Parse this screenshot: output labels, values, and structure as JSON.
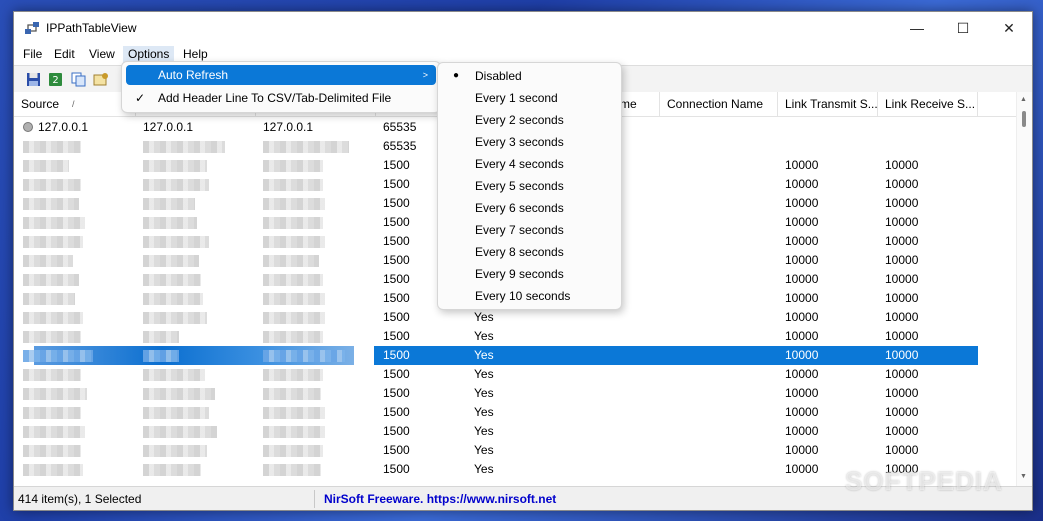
{
  "window": {
    "title": "IPPathTableView",
    "controls": {
      "minimize": "—",
      "maximize": "☐",
      "close": "✕"
    }
  },
  "menubar": {
    "items": [
      "File",
      "Edit",
      "View",
      "Options",
      "Help"
    ],
    "active": "Options"
  },
  "toolbar": {
    "icons": [
      "save-icon",
      "refresh-icon",
      "copy-icon",
      "properties-icon"
    ]
  },
  "table": {
    "columns": [
      "Source",
      "",
      "",
      "",
      "",
      "me",
      "Connection Name",
      "Link Transmit S...",
      "Link Receive S..."
    ],
    "rows": [
      {
        "c1": "127.0.0.1",
        "c2": "127.0.0.1",
        "c3": "127.0.0.1",
        "mtu": "65535",
        "yes": "",
        "tx": "",
        "rx": ""
      },
      {
        "c1": "",
        "c2": "",
        "c3": "",
        "mtu": "65535",
        "yes": "",
        "tx": "",
        "rx": ""
      },
      {
        "c1": "",
        "c2": "",
        "c3": "",
        "mtu": "1500",
        "yes": "",
        "tx": "10000",
        "rx": "10000"
      },
      {
        "c1": "",
        "c2": "",
        "c3": "",
        "mtu": "1500",
        "yes": "",
        "tx": "10000",
        "rx": "10000"
      },
      {
        "c1": "",
        "c2": "",
        "c3": "",
        "mtu": "1500",
        "yes": "",
        "tx": "10000",
        "rx": "10000"
      },
      {
        "c1": "",
        "c2": "",
        "c3": "",
        "mtu": "1500",
        "yes": "",
        "tx": "10000",
        "rx": "10000"
      },
      {
        "c1": "",
        "c2": "",
        "c3": "",
        "mtu": "1500",
        "yes": "",
        "tx": "10000",
        "rx": "10000"
      },
      {
        "c1": "",
        "c2": "",
        "c3": "",
        "mtu": "1500",
        "yes": "",
        "tx": "10000",
        "rx": "10000"
      },
      {
        "c1": "",
        "c2": "",
        "c3": "",
        "mtu": "1500",
        "yes": "",
        "tx": "10000",
        "rx": "10000"
      },
      {
        "c1": "",
        "c2": "",
        "c3": "",
        "mtu": "1500",
        "yes": "",
        "tx": "10000",
        "rx": "10000"
      },
      {
        "c1": "",
        "c2": "",
        "c3": "",
        "mtu": "1500",
        "yes": "Yes",
        "tx": "10000",
        "rx": "10000"
      },
      {
        "c1": "",
        "c2": "",
        "c3": "",
        "mtu": "1500",
        "yes": "Yes",
        "tx": "10000",
        "rx": "10000"
      },
      {
        "c1": "",
        "c2": "",
        "c3": "",
        "mtu": "1500",
        "yes": "Yes",
        "tx": "10000",
        "rx": "10000",
        "selected": true
      },
      {
        "c1": "",
        "c2": "",
        "c3": "",
        "mtu": "1500",
        "yes": "Yes",
        "tx": "10000",
        "rx": "10000"
      },
      {
        "c1": "",
        "c2": "",
        "c3": "",
        "mtu": "1500",
        "yes": "Yes",
        "tx": "10000",
        "rx": "10000"
      },
      {
        "c1": "",
        "c2": "",
        "c3": "",
        "mtu": "1500",
        "yes": "Yes",
        "tx": "10000",
        "rx": "10000"
      },
      {
        "c1": "",
        "c2": "",
        "c3": "",
        "mtu": "1500",
        "yes": "Yes",
        "tx": "10000",
        "rx": "10000"
      },
      {
        "c1": "",
        "c2": "",
        "c3": "",
        "mtu": "1500",
        "yes": "Yes",
        "tx": "10000",
        "rx": "10000"
      },
      {
        "c1": "",
        "c2": "",
        "c3": "",
        "mtu": "1500",
        "yes": "Yes",
        "tx": "10000",
        "rx": "10000"
      }
    ]
  },
  "options_menu": {
    "items": [
      {
        "label": "Auto Refresh",
        "submenu": true,
        "checked": false,
        "highlighted": true
      },
      {
        "label": "Add Header Line To CSV/Tab-Delimited File",
        "submenu": false,
        "checked": true,
        "highlighted": false
      }
    ]
  },
  "auto_refresh_submenu": {
    "items": [
      "Disabled",
      "Every 1 second",
      "Every 2 seconds",
      "Every 3 seconds",
      "Every 4 seconds",
      "Every 5 seconds",
      "Every 6 seconds",
      "Every 7 seconds",
      "Every 8 seconds",
      "Every 9 seconds",
      "Every 10 seconds"
    ],
    "selected": "Disabled"
  },
  "statusbar": {
    "count": "414 item(s), 1 Selected",
    "credit": "NirSoft Freeware. https://www.nirsoft.net"
  },
  "watermark": "SOFTPEDIA",
  "colors": {
    "accent": "#0b78d7",
    "credit": "#0000cc"
  }
}
